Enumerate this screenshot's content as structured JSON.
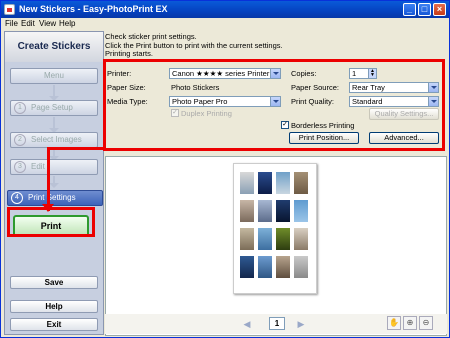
{
  "window": {
    "title": "New Stickers - Easy-PhotoPrint EX"
  },
  "titlebar_buttons": {
    "minimize": "_",
    "maximize": "□",
    "close": "×"
  },
  "menu": [
    "File",
    "Edit",
    "View",
    "Help"
  ],
  "sidebar": {
    "header": "Create Stickers",
    "menu_button": "Menu",
    "steps": [
      {
        "num": "1",
        "label": "Page Setup"
      },
      {
        "num": "2",
        "label": "Select Images"
      },
      {
        "num": "3",
        "label": "Edit"
      },
      {
        "num": "4",
        "label": "Print Settings"
      }
    ],
    "print_button": "Print",
    "save_button": "Save",
    "help_button": "Help",
    "exit_button": "Exit"
  },
  "instructions": [
    "Check sticker print settings.",
    "Click the Print button to print with the current settings.",
    "Printing starts."
  ],
  "settings": {
    "printer_label": "Printer:",
    "printer_value": "Canon ★★★★ series Printer",
    "paper_size_label": "Paper Size:",
    "paper_size_value": "Photo Stickers",
    "media_type_label": "Media Type:",
    "media_type_value": "Photo Paper Pro",
    "duplex_label": "Duplex Printing",
    "copies_label": "Copies:",
    "copies_value": "1",
    "paper_source_label": "Paper Source:",
    "paper_source_value": "Rear Tray",
    "print_quality_label": "Print Quality:",
    "print_quality_value": "Standard",
    "quality_settings_button": "Quality Settings...",
    "borderless_label": "Borderless Printing",
    "print_position_button": "Print Position...",
    "advanced_button": "Advanced..."
  },
  "preview": {
    "page_number": "1"
  },
  "colors": {
    "accent_red": "#ec0000",
    "print_green": "#2e9a2e",
    "title_blue": "#0542c0"
  }
}
